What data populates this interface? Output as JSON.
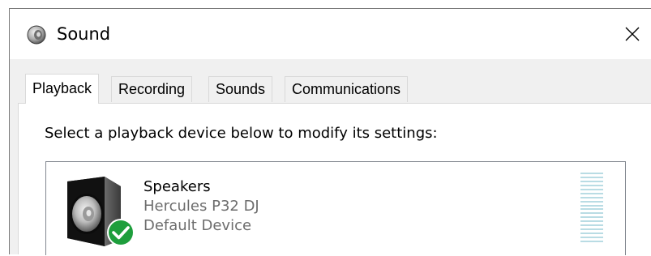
{
  "window": {
    "title": "Sound",
    "close_glyph": "✕"
  },
  "tabs": [
    {
      "label": "Playback",
      "active": true
    },
    {
      "label": "Recording",
      "active": false
    },
    {
      "label": "Sounds",
      "active": false
    },
    {
      "label": "Communications",
      "active": false
    }
  ],
  "playback": {
    "instruction": "Select a playback device below to modify its settings:",
    "devices": [
      {
        "name": "Speakers",
        "model": "Hercules P32 DJ",
        "status": "Default Device",
        "icon": "speaker-icon",
        "badge": "default-check-icon",
        "badge_color": "#1e9e3c",
        "level": 0
      }
    ]
  }
}
